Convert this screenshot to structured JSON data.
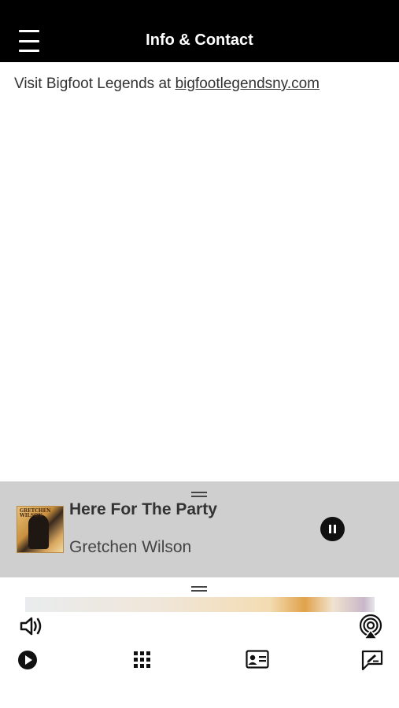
{
  "header": {
    "title": "Info & Contact",
    "menu_icon": "hamburger-menu-icon"
  },
  "content": {
    "text": "Visit Bigfoot Legends at ",
    "link_text": "bigfootlegendsny.com"
  },
  "now_playing": {
    "title": "Here For The Party",
    "artist": "Gretchen Wilson",
    "album_art_text": "GRETCHEN WILSON",
    "state_icon": "pause-icon"
  },
  "toolbar": {
    "icons": [
      "volume-icon",
      "airplay-icon",
      "play-icon",
      "grid-icon",
      "contact-card-icon",
      "chat-icon"
    ]
  },
  "colors": {
    "header_bg": "#000000",
    "now_playing_bg": "#cfcfcf",
    "text": "#333333"
  }
}
